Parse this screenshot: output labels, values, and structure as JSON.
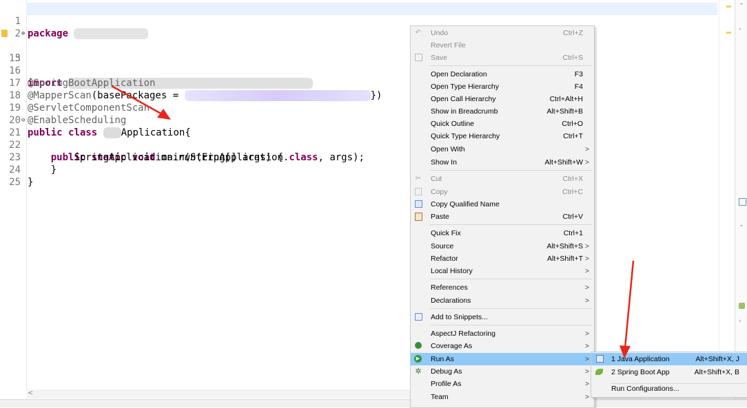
{
  "editor": {
    "lines": [
      {
        "n": "1",
        "kw": "package"
      },
      {
        "n": "2"
      },
      {
        "n": "3",
        "kw": "import"
      },
      {
        "n": "15"
      },
      {
        "n": "16",
        "text": "@SpringBootApplication"
      },
      {
        "n": "17",
        "text_a": "@MapperScan",
        "text_b": "(basePackages = ",
        "text_c": "})"
      },
      {
        "n": "18",
        "text": "@ServletComponentScan"
      },
      {
        "n": "19",
        "text": "@EnableScheduling"
      },
      {
        "n": "20",
        "kw_a": "public",
        "kw_b": "class",
        "text": "Application{"
      },
      {
        "n": "21",
        "kw_a": "public",
        "kw_b": "static",
        "kw_c": "void",
        "text": "main(String[] args) {"
      },
      {
        "n": "22",
        "text_a": "SpringApplication.",
        "run": "run",
        "text_b": "(ErpApplication.",
        "kw": "class",
        "text_c": ", args);"
      },
      {
        "n": "23",
        "text": "}"
      },
      {
        "n": "24",
        "text": "}"
      },
      {
        "n": "25"
      }
    ],
    "scroll_arrow": "<"
  },
  "menu": {
    "items": [
      {
        "label": "Undo",
        "shortcut": "Ctrl+Z",
        "disabled": true,
        "icon": "undo-icon"
      },
      {
        "label": "Revert File",
        "shortcut": "",
        "disabled": true
      },
      {
        "label": "Save",
        "shortcut": "Ctrl+S",
        "disabled": true,
        "icon": "save-icon"
      },
      {
        "label": "Open Declaration",
        "shortcut": "F3"
      },
      {
        "label": "Open Type Hierarchy",
        "shortcut": "F4"
      },
      {
        "label": "Open Call Hierarchy",
        "shortcut": "Ctrl+Alt+H"
      },
      {
        "label": "Show in Breadcrumb",
        "shortcut": "Alt+Shift+B"
      },
      {
        "label": "Quick Outline",
        "shortcut": "Ctrl+O"
      },
      {
        "label": "Quick Type Hierarchy",
        "shortcut": "Ctrl+T"
      },
      {
        "label": "Open With",
        "shortcut": "",
        "submenu": true
      },
      {
        "label": "Show In",
        "shortcut": "Alt+Shift+W",
        "submenu": true
      },
      {
        "label": "Cut",
        "shortcut": "Ctrl+X",
        "disabled": true,
        "icon": "cut-icon"
      },
      {
        "label": "Copy",
        "shortcut": "Ctrl+C",
        "disabled": true,
        "icon": "copy-icon"
      },
      {
        "label": "Copy Qualified Name",
        "shortcut": "",
        "icon": "copy-qualified-name-icon"
      },
      {
        "label": "Paste",
        "shortcut": "Ctrl+V",
        "icon": "paste-icon"
      },
      {
        "label": "Quick Fix",
        "shortcut": "Ctrl+1"
      },
      {
        "label": "Source",
        "shortcut": "Alt+Shift+S",
        "submenu": true
      },
      {
        "label": "Refactor",
        "shortcut": "Alt+Shift+T",
        "submenu": true
      },
      {
        "label": "Local History",
        "shortcut": "",
        "submenu": true
      },
      {
        "label": "References",
        "shortcut": "",
        "submenu": true
      },
      {
        "label": "Declarations",
        "shortcut": "",
        "submenu": true
      },
      {
        "label": "Add to Snippets...",
        "shortcut": "",
        "icon": "snippets-icon"
      },
      {
        "label": "AspectJ Refactoring",
        "shortcut": "",
        "submenu": true
      },
      {
        "label": "Coverage As",
        "shortcut": "",
        "submenu": true,
        "icon": "coverage-icon"
      },
      {
        "label": "Run As",
        "shortcut": "",
        "submenu": true,
        "highlighted": true,
        "icon": "run-icon"
      },
      {
        "label": "Debug As",
        "shortcut": "",
        "submenu": true,
        "icon": "debug-icon"
      },
      {
        "label": "Profile As",
        "shortcut": "",
        "submenu": true
      },
      {
        "label": "Team",
        "shortcut": "",
        "submenu": true
      }
    ],
    "submenu_arrow": ">"
  },
  "run_as_submenu": {
    "items": [
      {
        "label": "1 Java Application",
        "shortcut": "Alt+Shift+X, J",
        "highlighted": true,
        "icon": "java-application-icon"
      },
      {
        "label": "2 Spring Boot App",
        "shortcut": "Alt+Shift+X, B",
        "icon": "spring-boot-icon"
      },
      {
        "label": "Run Configurations...",
        "shortcut": ""
      }
    ]
  },
  "colors": {
    "keyword": "#7f0055",
    "annotation": "#646464",
    "menu_highlight": "#91c9f7",
    "arrow": "#e8261c"
  }
}
